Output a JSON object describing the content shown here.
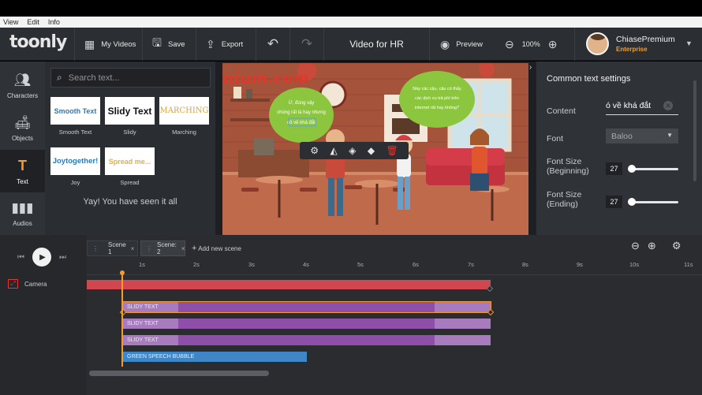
{
  "menu": {
    "items": [
      "View",
      "Edit",
      "Info"
    ]
  },
  "header": {
    "logo": "toonly",
    "my_videos": "My Videos",
    "save": "Save",
    "export": "Export",
    "project_title": "Video for HR",
    "preview": "Preview",
    "zoom": "100%",
    "user_name": "ChiasePremium",
    "user_plan": "Enterprise"
  },
  "sidebar": {
    "items": [
      {
        "label": "Characters",
        "icon": "users-icon"
      },
      {
        "label": "Objects",
        "icon": "sofa-icon"
      },
      {
        "label": "Text",
        "icon": "text-icon"
      },
      {
        "label": "Audios",
        "icon": "waveform-icon"
      }
    ]
  },
  "text_panel": {
    "search_placeholder": "Search text...",
    "styles": [
      {
        "preview": "Smooth Text",
        "label": "Smooth Text",
        "color": "#2a7ab8"
      },
      {
        "preview": "Slidy Text",
        "label": "Slidy",
        "color": "#111111"
      },
      {
        "preview": "MARCHING",
        "label": "Marching",
        "color": "#d9a441"
      },
      {
        "preview": "Joytogether!",
        "label": "Joy",
        "color": "#2a7ab8"
      },
      {
        "preview": "Spread me...",
        "label": "Spread",
        "color": "#e0b050"
      }
    ],
    "end_message": "Yay! You have seen it all"
  },
  "canvas": {
    "watermark": "ChiasePremium.com",
    "bubble_left_text": "Ừ, đúng vậy chúng rất là hay nhưng cô về khá đắt",
    "bubble_right_text": "Này các cậu, cậu có thấy các dịch vụ trả phí trên internet rất hay không?"
  },
  "settings": {
    "title": "Common text settings",
    "content_label": "Content",
    "content_value": "ó về khá đắt",
    "font_label": "Font",
    "font_value": "Baloo",
    "size_begin_label": "Font Size (Beginning)",
    "size_begin_value": "27",
    "size_end_label": "Font Size (Ending)",
    "size_end_value": "27"
  },
  "timeline": {
    "scene_tabs": [
      "Scene 1",
      "Scene: 2"
    ],
    "add_scene": "Add new scene",
    "camera_label": "Camera",
    "ticks": [
      "1s",
      "2s",
      "3s",
      "4s",
      "5s",
      "6s",
      "7s",
      "8s",
      "9s",
      "10s",
      "11s"
    ],
    "tracks": [
      {
        "label": "SLIDY TEXT",
        "selected": true
      },
      {
        "label": "SLIDY TEXT",
        "selected": false
      },
      {
        "label": "SLIDY TEXT",
        "selected": false
      },
      {
        "label": "GREEN SPEECH BUBBLE",
        "selected": false
      }
    ]
  },
  "colors": {
    "accent": "#f39c2b",
    "header_bg": "#2b2e33",
    "camera_track": "#d2474f",
    "text_track": "#8e4fa8",
    "bubble_track": "#3f86c7"
  }
}
